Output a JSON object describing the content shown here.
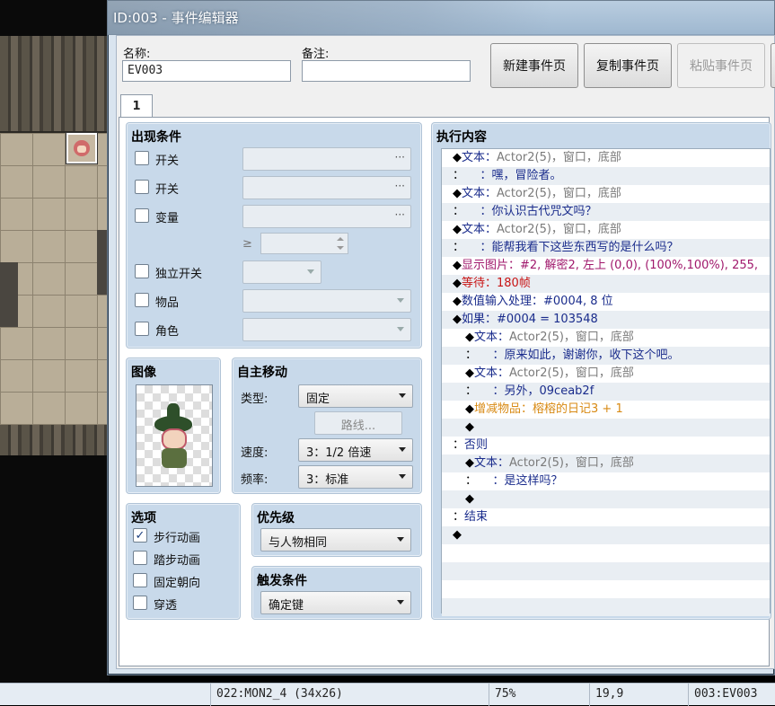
{
  "window": {
    "title": "ID:003 - 事件编辑器"
  },
  "form": {
    "name_label": "名称:",
    "name_value": "EV003",
    "note_label": "备注:",
    "note_value": ""
  },
  "buttons": {
    "new_page": "新建事件页",
    "copy_page": "复制事件页",
    "paste_page": "粘贴事件页"
  },
  "tabs": [
    {
      "label": "1"
    }
  ],
  "conditions": {
    "title": "出现条件",
    "switch1": "开关",
    "switch2": "开关",
    "variable": "变量",
    "gte": "≥",
    "self_switch": "独立开关",
    "item": "物品",
    "actor": "角色",
    "dots": "···"
  },
  "image": {
    "title": "图像"
  },
  "autonomous": {
    "title": "自主移动",
    "type_label": "类型:",
    "type_value": "固定",
    "route_button": "路线...",
    "speed_label": "速度:",
    "speed_value": "3：1/2 倍速",
    "freq_label": "频率:",
    "freq_value": "3：标准"
  },
  "options": {
    "title": "选项",
    "walking": "步行动画",
    "stepping": "踏步动画",
    "direction_fix": "固定朝向",
    "through": "穿透",
    "walking_checked": true,
    "stepping_checked": false,
    "direction_fix_checked": false,
    "through_checked": false
  },
  "priority": {
    "title": "优先级",
    "value": "与人物相同"
  },
  "trigger": {
    "title": "触发条件",
    "value": "确定键"
  },
  "contents": {
    "title": "执行内容",
    "rows": [
      {
        "prefix": "◆",
        "cmd": "文本：",
        "rest": "Actor2(5)，窗口，底部",
        "cmd_color": "#1a2c8c",
        "rest_color": "#7a7a7a",
        "indent": 0
      },
      {
        "prefix": "：",
        "cmd": "",
        "rest": "：嘿，冒险者。",
        "cmd_color": "#1a2c8c",
        "rest_color": "#1a2c8c",
        "indent": 0
      },
      {
        "prefix": "◆",
        "cmd": "文本：",
        "rest": "Actor2(5)，窗口，底部",
        "cmd_color": "#1a2c8c",
        "rest_color": "#7a7a7a",
        "indent": 0
      },
      {
        "prefix": "：",
        "cmd": "",
        "rest": "：你认识古代咒文吗？",
        "cmd_color": "#1a2c8c",
        "rest_color": "#1a2c8c",
        "indent": 0
      },
      {
        "prefix": "◆",
        "cmd": "文本：",
        "rest": "Actor2(5)，窗口，底部",
        "cmd_color": "#1a2c8c",
        "rest_color": "#7a7a7a",
        "indent": 0
      },
      {
        "prefix": "：",
        "cmd": "",
        "rest": "：能帮我看下这些东西写的是什么吗？",
        "cmd_color": "#1a2c8c",
        "rest_color": "#1a2c8c",
        "indent": 0
      },
      {
        "prefix": "◆",
        "cmd": "显示图片：",
        "rest": "#2, 解密2, 左上 (0,0), (100%,100%), 255,",
        "cmd_color": "#a0186c",
        "rest_color": "#a0186c",
        "indent": 0
      },
      {
        "prefix": "◆",
        "cmd": "等待：",
        "rest": "180帧",
        "cmd_color": "#c81414",
        "rest_color": "#c81414",
        "indent": 0
      },
      {
        "prefix": "◆",
        "cmd": "数值输入处理：",
        "rest": "#0004, 8 位",
        "cmd_color": "#1a2c8c",
        "rest_color": "#1a2c8c",
        "indent": 0
      },
      {
        "prefix": "◆",
        "cmd": "如果：",
        "rest": "#0004 = 103548",
        "cmd_color": "#1a2c8c",
        "rest_color": "#1a2c8c",
        "indent": 0
      },
      {
        "prefix": "◆",
        "cmd": "文本：",
        "rest": "Actor2(5)，窗口，底部",
        "cmd_color": "#1a2c8c",
        "rest_color": "#7a7a7a",
        "indent": 1
      },
      {
        "prefix": "：",
        "cmd": "",
        "rest": "：原来如此，谢谢你，收下这个吧。",
        "cmd_color": "#1a2c8c",
        "rest_color": "#1a2c8c",
        "indent": 1
      },
      {
        "prefix": "◆",
        "cmd": "文本：",
        "rest": "Actor2(5)，窗口，底部",
        "cmd_color": "#1a2c8c",
        "rest_color": "#7a7a7a",
        "indent": 1
      },
      {
        "prefix": "：",
        "cmd": "",
        "rest": "：另外，09ceab2f",
        "cmd_color": "#1a2c8c",
        "rest_color": "#1a2c8c",
        "indent": 1
      },
      {
        "prefix": "◆",
        "cmd": "增减物品：",
        "rest": "榕榕的日记3 + 1",
        "cmd_color": "#d88a14",
        "rest_color": "#d88a14",
        "indent": 1
      },
      {
        "prefix": "◆",
        "cmd": "",
        "rest": "",
        "cmd_color": "#1a2c8c",
        "rest_color": "#1a2c8c",
        "indent": 1
      },
      {
        "prefix": "：",
        "cmd": "否则",
        "rest": "",
        "cmd_color": "#1a2c8c",
        "rest_color": "#1a2c8c",
        "indent": 0
      },
      {
        "prefix": "◆",
        "cmd": "文本：",
        "rest": "Actor2(5)，窗口，底部",
        "cmd_color": "#1a2c8c",
        "rest_color": "#7a7a7a",
        "indent": 1
      },
      {
        "prefix": "：",
        "cmd": "",
        "rest": "：是这样吗？",
        "cmd_color": "#1a2c8c",
        "rest_color": "#1a2c8c",
        "indent": 1
      },
      {
        "prefix": "◆",
        "cmd": "",
        "rest": "",
        "cmd_color": "#1a2c8c",
        "rest_color": "#1a2c8c",
        "indent": 1
      },
      {
        "prefix": "：",
        "cmd": "结束",
        "rest": "",
        "cmd_color": "#1a2c8c",
        "rest_color": "#1a2c8c",
        "indent": 0
      },
      {
        "prefix": "◆",
        "cmd": "",
        "rest": "",
        "cmd_color": "#1a2c8c",
        "rest_color": "#1a2c8c",
        "indent": 0
      },
      {
        "prefix": "",
        "cmd": "",
        "rest": "",
        "cmd_color": "#1a2c8c",
        "rest_color": "#1a2c8c",
        "indent": 0
      },
      {
        "prefix": "",
        "cmd": "",
        "rest": "",
        "cmd_color": "#1a2c8c",
        "rest_color": "#1a2c8c",
        "indent": 0
      },
      {
        "prefix": "",
        "cmd": "",
        "rest": "",
        "cmd_color": "#1a2c8c",
        "rest_color": "#1a2c8c",
        "indent": 0
      },
      {
        "prefix": "",
        "cmd": "",
        "rest": "",
        "cmd_color": "#1a2c8c",
        "rest_color": "#1a2c8c",
        "indent": 0
      }
    ]
  },
  "statusbar": {
    "map": "022:MON2_4 (34x26)",
    "zoom": "75%",
    "coords": "19,9",
    "event": "003:EV003"
  }
}
